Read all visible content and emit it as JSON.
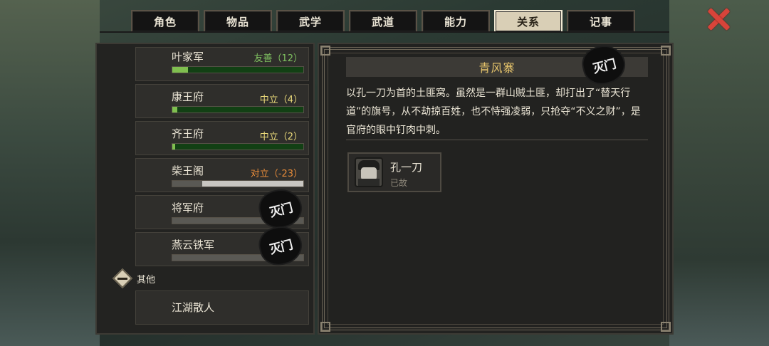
{
  "tabs": [
    {
      "label": "角色",
      "active": false
    },
    {
      "label": "物品",
      "active": false
    },
    {
      "label": "武学",
      "active": false
    },
    {
      "label": "武道",
      "active": false
    },
    {
      "label": "能力",
      "active": false
    },
    {
      "label": "关系",
      "active": true
    },
    {
      "label": "记事",
      "active": false
    }
  ],
  "factions": [
    {
      "name": "叶家军",
      "status": "友善（12）",
      "tone": "good",
      "relation": 0.12,
      "bar": "green",
      "destroyed": false
    },
    {
      "name": "康王府",
      "status": "中立（4）",
      "tone": "neutral",
      "relation": 0.04,
      "bar": "green",
      "destroyed": false
    },
    {
      "name": "齐王府",
      "status": "中立（2）",
      "tone": "neutral",
      "relation": 0.02,
      "bar": "green",
      "destroyed": false
    },
    {
      "name": "柴王阁",
      "status": "对立（-23）",
      "tone": "bad",
      "relation": 0.23,
      "bar": "grey",
      "destroyed": false
    },
    {
      "name": "将军府",
      "status": "",
      "tone": "",
      "relation": 1.0,
      "bar": "grey",
      "destroyed": true
    },
    {
      "name": "燕云铁军",
      "status": "",
      "tone": "",
      "relation": 1.0,
      "bar": "grey",
      "destroyed": true
    }
  ],
  "group_other": {
    "label": "其他",
    "items": [
      "江湖散人"
    ]
  },
  "stamp_text": "灭门",
  "detail": {
    "title": "青风寨",
    "destroyed": true,
    "description": "以孔一刀为首的土匪窝。虽然是一群山贼土匪，却打出了“替天行道”的旗号，从不劫掠百姓，也不恃强凌弱，只抢夺“不义之财”，是官府的眼中钉肉中刺。",
    "members": [
      {
        "name": "孔一刀",
        "status": "已故"
      }
    ]
  }
}
